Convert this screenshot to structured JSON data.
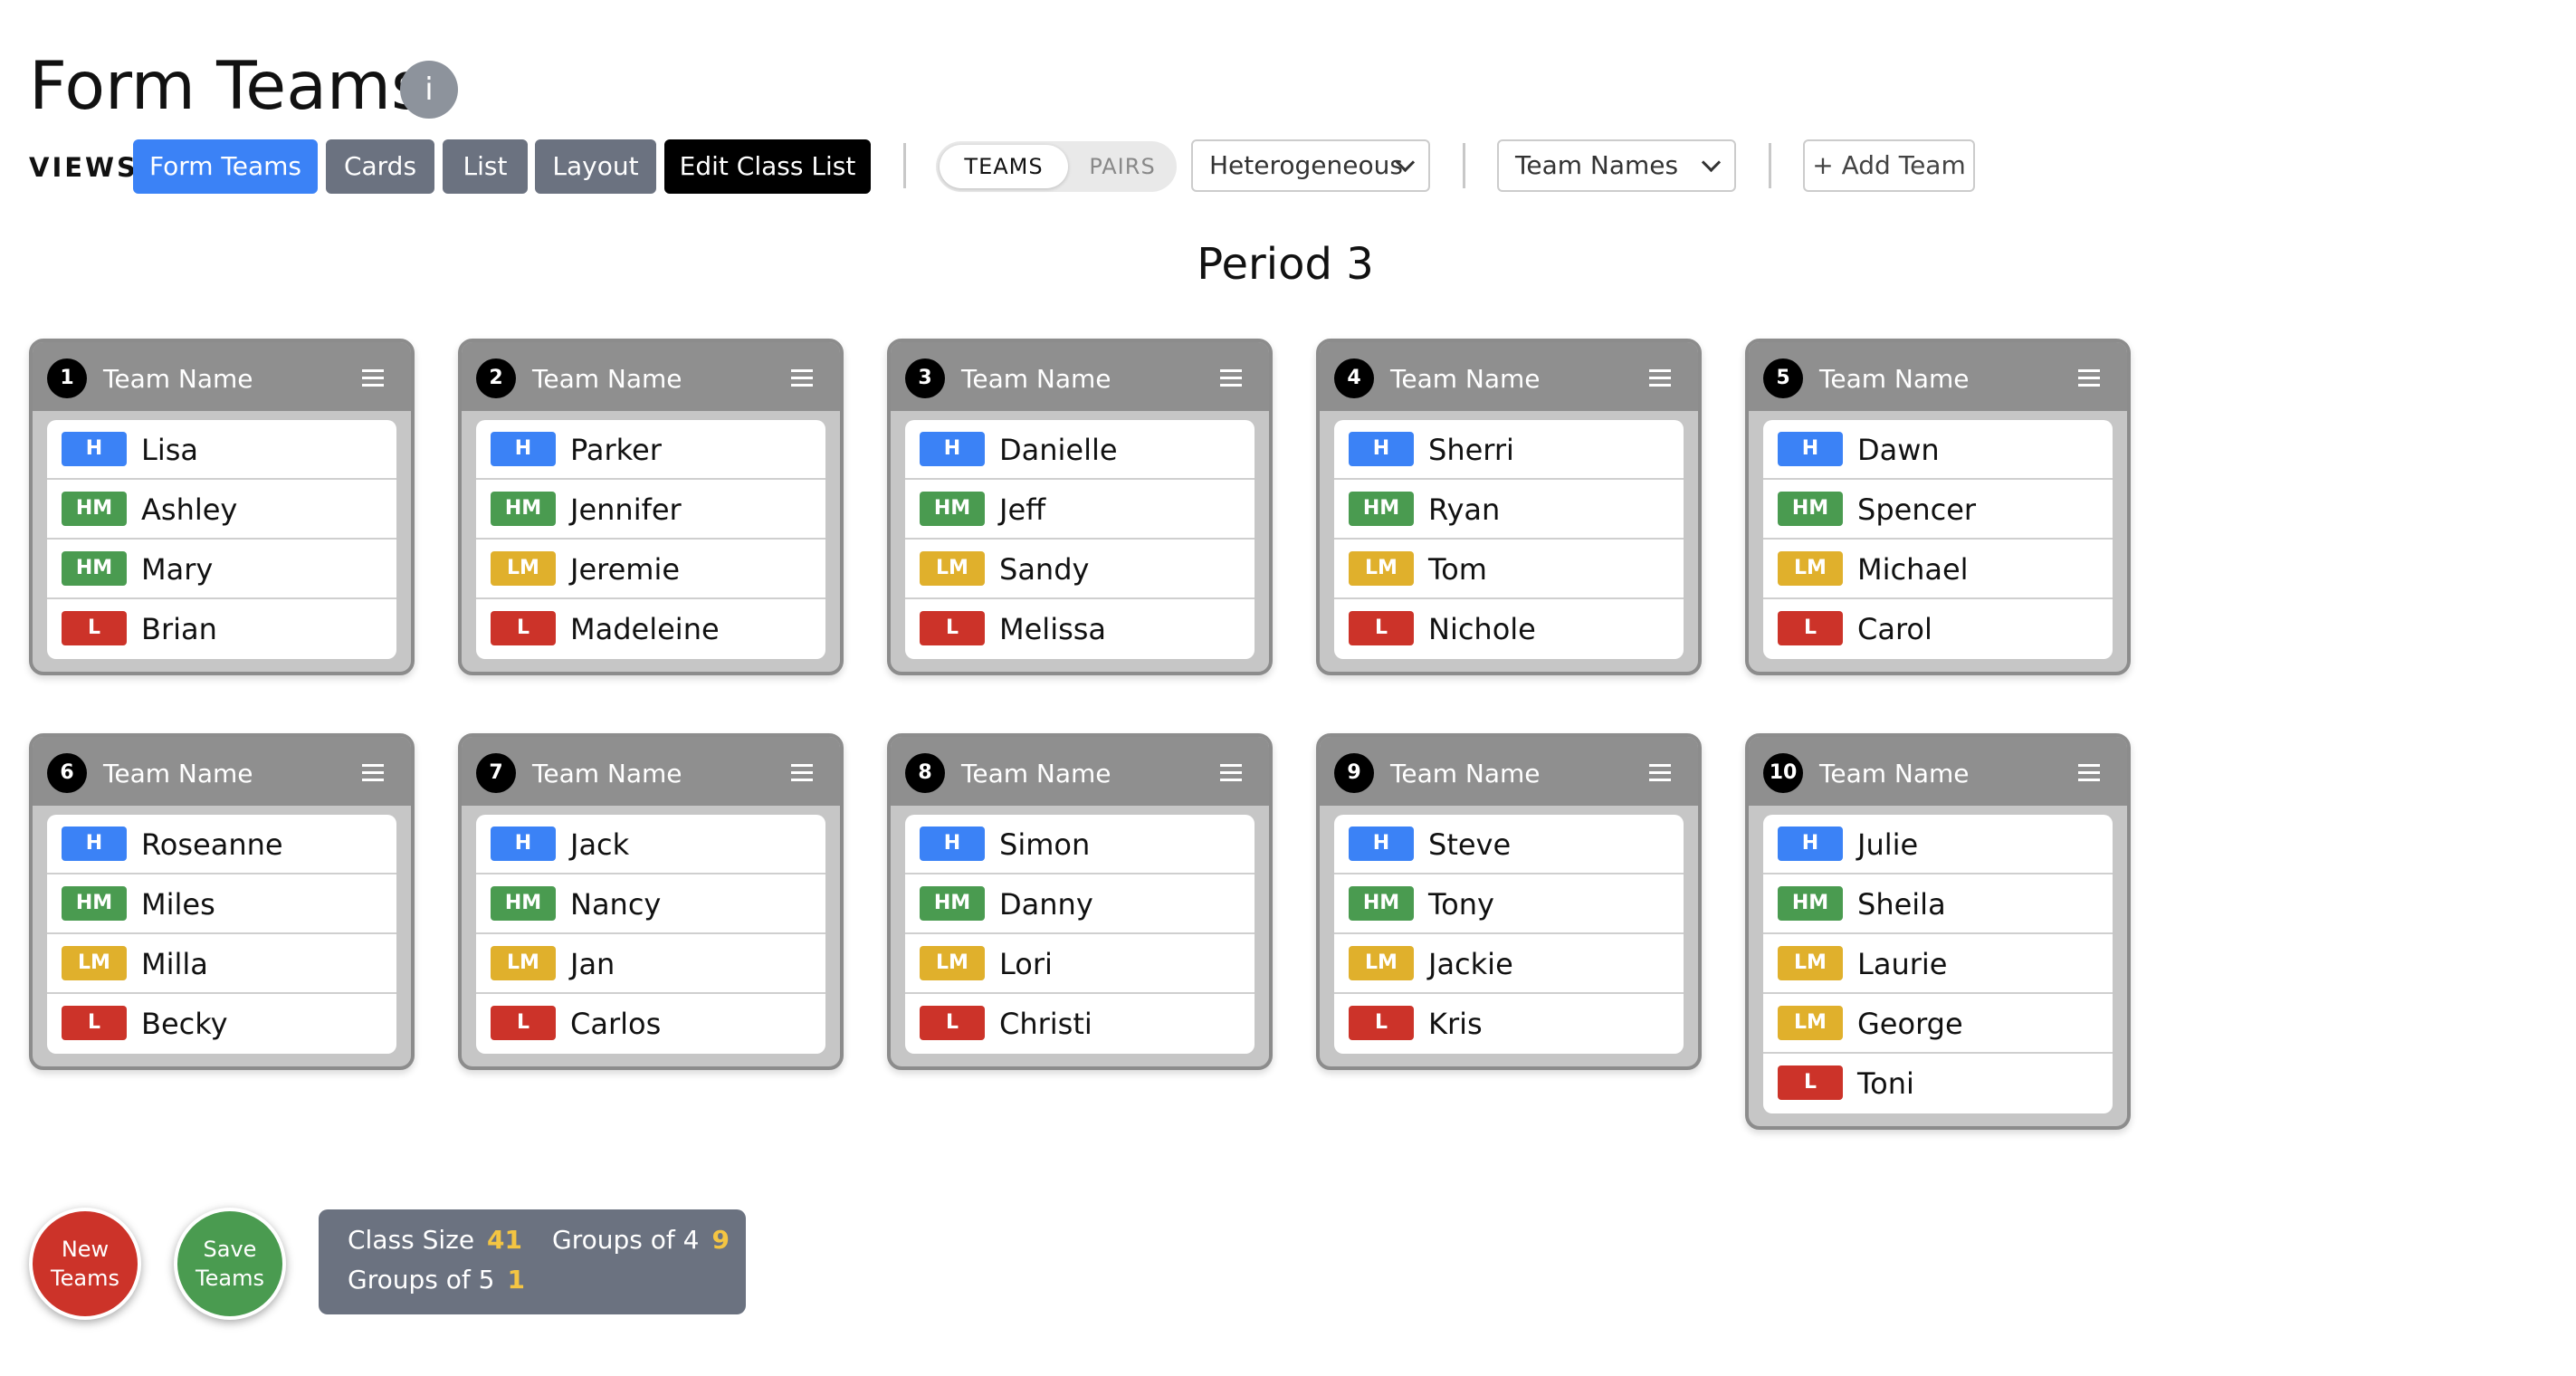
{
  "header": {
    "title": "Form Teams",
    "info_icon": "i"
  },
  "views": {
    "label": "VIEWS",
    "buttons": [
      "Form Teams",
      "Cards",
      "List",
      "Layout",
      "Edit Class List"
    ],
    "active": "Form Teams"
  },
  "toggle": {
    "on": "TEAMS",
    "off": "PAIRS"
  },
  "grouping_select": {
    "value": "Heterogeneous"
  },
  "names_select": {
    "value": "Team Names"
  },
  "add_team_label": "+ Add Team",
  "period_title": "Period 3",
  "colors": {
    "H": "#3b82f6",
    "HM": "#4a9b50",
    "LM": "#e0b02c",
    "L": "#cc3329",
    "primary": "#3b82f6",
    "secondary": "#6b7280"
  },
  "teams": [
    {
      "number": "1",
      "name": "Team Name",
      "members": [
        {
          "level": "H",
          "name": "Lisa"
        },
        {
          "level": "HM",
          "name": "Ashley"
        },
        {
          "level": "HM",
          "name": "Mary"
        },
        {
          "level": "L",
          "name": "Brian"
        }
      ]
    },
    {
      "number": "2",
      "name": "Team Name",
      "members": [
        {
          "level": "H",
          "name": "Parker"
        },
        {
          "level": "HM",
          "name": "Jennifer"
        },
        {
          "level": "LM",
          "name": "Jeremie"
        },
        {
          "level": "L",
          "name": "Madeleine"
        }
      ]
    },
    {
      "number": "3",
      "name": "Team Name",
      "members": [
        {
          "level": "H",
          "name": "Danielle"
        },
        {
          "level": "HM",
          "name": "Jeff"
        },
        {
          "level": "LM",
          "name": "Sandy"
        },
        {
          "level": "L",
          "name": "Melissa"
        }
      ]
    },
    {
      "number": "4",
      "name": "Team Name",
      "members": [
        {
          "level": "H",
          "name": "Sherri"
        },
        {
          "level": "HM",
          "name": "Ryan"
        },
        {
          "level": "LM",
          "name": "Tom"
        },
        {
          "level": "L",
          "name": "Nichole"
        }
      ]
    },
    {
      "number": "5",
      "name": "Team Name",
      "members": [
        {
          "level": "H",
          "name": "Dawn"
        },
        {
          "level": "HM",
          "name": "Spencer"
        },
        {
          "level": "LM",
          "name": "Michael"
        },
        {
          "level": "L",
          "name": "Carol"
        }
      ]
    },
    {
      "number": "6",
      "name": "Team Name",
      "members": [
        {
          "level": "H",
          "name": "Roseanne"
        },
        {
          "level": "HM",
          "name": "Miles"
        },
        {
          "level": "LM",
          "name": "Milla"
        },
        {
          "level": "L",
          "name": "Becky"
        }
      ]
    },
    {
      "number": "7",
      "name": "Team Name",
      "members": [
        {
          "level": "H",
          "name": "Jack"
        },
        {
          "level": "HM",
          "name": "Nancy"
        },
        {
          "level": "LM",
          "name": "Jan"
        },
        {
          "level": "L",
          "name": "Carlos"
        }
      ]
    },
    {
      "number": "8",
      "name": "Team Name",
      "members": [
        {
          "level": "H",
          "name": "Simon"
        },
        {
          "level": "HM",
          "name": "Danny"
        },
        {
          "level": "LM",
          "name": "Lori"
        },
        {
          "level": "L",
          "name": "Christi"
        }
      ]
    },
    {
      "number": "9",
      "name": "Team Name",
      "members": [
        {
          "level": "H",
          "name": "Steve"
        },
        {
          "level": "HM",
          "name": "Tony"
        },
        {
          "level": "LM",
          "name": "Jackie"
        },
        {
          "level": "L",
          "name": "Kris"
        }
      ]
    },
    {
      "number": "10",
      "name": "Team Name",
      "members": [
        {
          "level": "H",
          "name": "Julie"
        },
        {
          "level": "HM",
          "name": "Sheila"
        },
        {
          "level": "LM",
          "name": "Laurie"
        },
        {
          "level": "LM",
          "name": "George"
        },
        {
          "level": "L",
          "name": "Toni"
        }
      ]
    }
  ],
  "actions": {
    "new_teams": "New Teams",
    "save_teams": "Save Teams"
  },
  "stats": {
    "class_size_label": "Class Size",
    "class_size": "41",
    "groups4_label": "Groups of 4",
    "groups4": "9",
    "groups5_label": "Groups of 5",
    "groups5": "1"
  }
}
